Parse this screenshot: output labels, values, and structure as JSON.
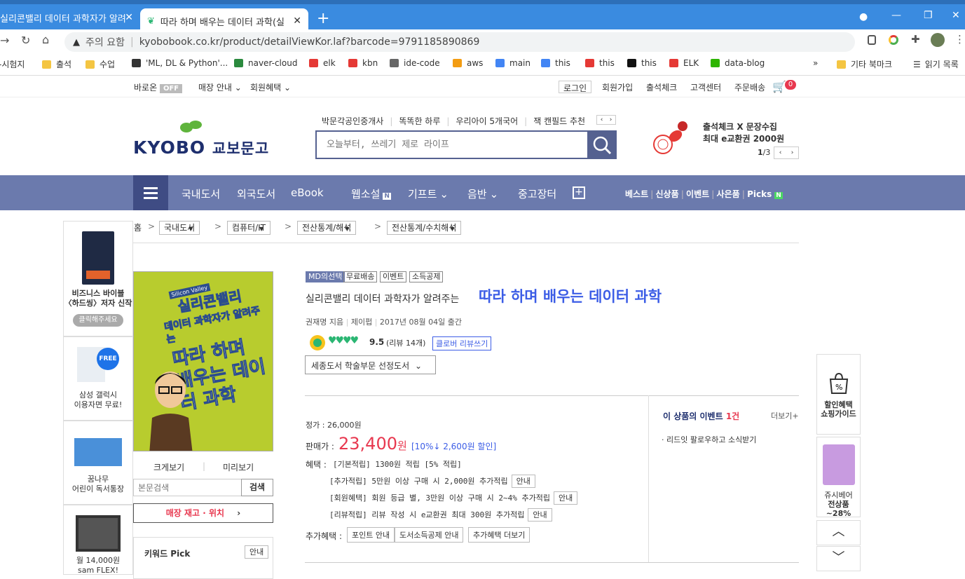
{
  "browser": {
    "tab_inactive": "실리콘밸리 데이터 과학자가 알려",
    "tab_active": "따라 하며 배우는 데이터 과학(실",
    "url_warning": "주의 요함",
    "url": "kyobobook.co.kr/product/detailViewKor.laf?barcode=9791185890869",
    "bookmarks": [
      "-시험지",
      "출석",
      "수업",
      "'ML, DL & Python'...",
      "naver-cloud",
      "elk",
      "kbn",
      "ide-code",
      "aws",
      "main",
      "this",
      "this",
      "this",
      "ELK",
      "data-blog"
    ],
    "other_bookmarks": "기타 북마크",
    "reading_list": "읽기 목록"
  },
  "util": {
    "baroon": "바로온",
    "off": "OFF",
    "store_info": "매장 안내",
    "member_benefit": "회원혜택",
    "login": "로그인",
    "join": "회원가입",
    "attendance": "출석체크",
    "cs": "고객센터",
    "order_delivery": "주문배송",
    "cart_count": "0"
  },
  "header": {
    "logo_en": "KYOBO",
    "logo_kr": "교보문고",
    "hot_keywords": [
      "박문각공인중개사",
      "똑똑한 하루",
      "우리아이 5개국어",
      "잭 캔필드 추천"
    ],
    "search_placeholder": "오늘부터, 쓰레기 제로 라이프",
    "promo_line1": "출석체크 X 문장수집",
    "promo_line2": "최대 e교환권 2000원",
    "promo_page": "1",
    "promo_total": "/3"
  },
  "nav": {
    "items": [
      "국내도서",
      "외국도서",
      "eBook",
      "웹소설",
      "기프트",
      "음반",
      "중고장터"
    ],
    "right": [
      "베스트",
      "신상품",
      "이벤트",
      "사은품",
      "Picks"
    ]
  },
  "breadcrumb": [
    "홈",
    "국내도서",
    "컴퓨터/IT",
    "전산통계/해석",
    "전산통계/수치해석"
  ],
  "left_ads": [
    {
      "title": "비즈니스 바이블\n〈하드씽〉저자 신작",
      "cta": "클릭해주세요"
    },
    {
      "title": "삼성 갤럭시\n이용자면 무료!",
      "badge": "FREE"
    },
    {
      "title": "꿈나무\n어린이 독서통장"
    },
    {
      "title": "월 14,000원\nsam FLEX!"
    }
  ],
  "book": {
    "badges": [
      "MD의선택",
      "무료배송",
      "이벤트",
      "소득공제"
    ],
    "subtitle": "실리콘밸리 데이터 과학자가 알려주는",
    "title": "따라 하며 배우는 데이터 과학",
    "author": "권재명 지음",
    "publisher": "제이펍",
    "pub_date": "2017년 08월 04일 출간",
    "rating": "9.5",
    "reviews": "(리뷰 14개)",
    "review_btn": "클로버 리뷰쓰기",
    "award": "세종도서 학술부문 선정도서",
    "cover_title_1": "실리콘밸리",
    "cover_title_2": "데이터 과학자가 알려주는",
    "cover_title_3": "따라 하며 배우는 데이터 과학",
    "cover_top": "Silicon Valley",
    "enlarge": "크게보기",
    "preview": "미리보기",
    "content_search_placeholder": "본문검색",
    "content_search_btn": "검색",
    "stock": "매장 재고 · 위치",
    "keyword_pick": "키워드 Pick",
    "keyword_info": "안내"
  },
  "price": {
    "list_label": "정가 :",
    "list_price": "26,000원",
    "sale_label": "판매가 :",
    "sale_price": "23,400",
    "won": "원",
    "discount": "[10%↓ 2,600원 할인]",
    "benefit_label": "혜택 :",
    "benefits": [
      "[기본적립] 1300원 적립 [5% 적립]",
      "[추가적립] 5만원 이상 구매 시 2,000원 추가적립",
      "[회원혜택] 회원 등급 별, 3만원 이상 구매 시 2~4% 추가적립",
      "[리뷰적립] 리뷰 작성 시 e교환권 최대 300원 추가적립"
    ],
    "info": "안내",
    "extra_label": "추가혜택 :",
    "extra": [
      "포인트 안내",
      "도서소득공제 안내",
      "추가혜택 더보기"
    ]
  },
  "event": {
    "title": "이 상품의 이벤트",
    "count": "1건",
    "more": "더보기+",
    "item": "· 리드잇 팔로우하고 소식받기"
  },
  "right_side": {
    "guide_1": "할인혜택",
    "guide_2": "쇼핑가이드",
    "item_1": "쥬시베어",
    "item_2": "전상품 ~28%"
  },
  "colors": {
    "accent": "#6b7aad",
    "price": "#e8384f",
    "title": "#3c5de6",
    "green": "#2bb673"
  }
}
